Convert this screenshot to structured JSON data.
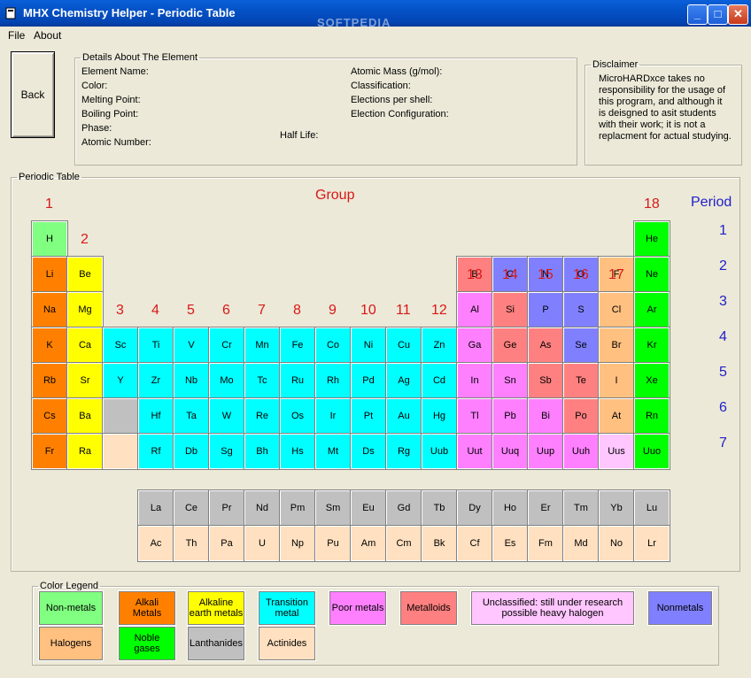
{
  "window": {
    "title": "MHX Chemistry Helper - Periodic Table",
    "watermark": "SOFTPEDIA",
    "watermark_url": "www.softpedia.com"
  },
  "menu": [
    "File",
    "About"
  ],
  "back_label": "Back",
  "details": {
    "legend": "Details About The Element",
    "left": [
      "Element Name:",
      "Color:",
      "Melting Point:",
      "Boiling Point:",
      "Phase:",
      "Atomic Number:"
    ],
    "right": [
      "Atomic Mass (g/mol):",
      "Classification:",
      "Elections per shell:",
      "Election Configuration:"
    ],
    "half_life": "Half Life:"
  },
  "disclaimer": {
    "legend": "Disclaimer",
    "text": "MicroHARDxce takes no responsibility for the usage of this program, and although it is deisgned to asit students  with their work; it is not a replacment for actual studying."
  },
  "periodic": {
    "legend": "Periodic Table",
    "group_title": "Group",
    "period_title": "Period",
    "groups": [
      "1",
      "2",
      "3",
      "4",
      "5",
      "6",
      "7",
      "8",
      "9",
      "10",
      "11",
      "12",
      "13",
      "14",
      "15",
      "16",
      "17",
      "18"
    ],
    "periods": [
      "1",
      "2",
      "3",
      "4",
      "5",
      "6",
      "7"
    ]
  },
  "colors": {
    "nonmetal": "#80ff80",
    "alkali": "#ff8000",
    "alkaline": "#ffff00",
    "transition": "#00ffff",
    "poor": "#ff80ff",
    "metalloid": "#ff8080",
    "unclassified": "#ffc6ff",
    "nonmetals": "#8080ff",
    "halogen": "#ffc080",
    "noble": "#00ff00",
    "lanthanide": "#c0c0c0",
    "actinide": "#ffe0c0",
    "blank": "#c0c0c0"
  },
  "elements": [
    {
      "s": "H",
      "r": 1,
      "c": 1,
      "t": "nonmetal"
    },
    {
      "s": "He",
      "r": 1,
      "c": 18,
      "t": "noble"
    },
    {
      "s": "Li",
      "r": 2,
      "c": 1,
      "t": "alkali"
    },
    {
      "s": "Be",
      "r": 2,
      "c": 2,
      "t": "alkaline"
    },
    {
      "s": "B",
      "r": 2,
      "c": 13,
      "t": "metalloid"
    },
    {
      "s": "C",
      "r": 2,
      "c": 14,
      "t": "nonmetals"
    },
    {
      "s": "N",
      "r": 2,
      "c": 15,
      "t": "nonmetals"
    },
    {
      "s": "O",
      "r": 2,
      "c": 16,
      "t": "nonmetals"
    },
    {
      "s": "F",
      "r": 2,
      "c": 17,
      "t": "halogen"
    },
    {
      "s": "Ne",
      "r": 2,
      "c": 18,
      "t": "noble"
    },
    {
      "s": "Na",
      "r": 3,
      "c": 1,
      "t": "alkali"
    },
    {
      "s": "Mg",
      "r": 3,
      "c": 2,
      "t": "alkaline"
    },
    {
      "s": "Al",
      "r": 3,
      "c": 13,
      "t": "poor"
    },
    {
      "s": "Si",
      "r": 3,
      "c": 14,
      "t": "metalloid"
    },
    {
      "s": "P",
      "r": 3,
      "c": 15,
      "t": "nonmetals"
    },
    {
      "s": "S",
      "r": 3,
      "c": 16,
      "t": "nonmetals"
    },
    {
      "s": "Cl",
      "r": 3,
      "c": 17,
      "t": "halogen"
    },
    {
      "s": "Ar",
      "r": 3,
      "c": 18,
      "t": "noble"
    },
    {
      "s": "K",
      "r": 4,
      "c": 1,
      "t": "alkali"
    },
    {
      "s": "Ca",
      "r": 4,
      "c": 2,
      "t": "alkaline"
    },
    {
      "s": "Sc",
      "r": 4,
      "c": 3,
      "t": "transition"
    },
    {
      "s": "Ti",
      "r": 4,
      "c": 4,
      "t": "transition"
    },
    {
      "s": "V",
      "r": 4,
      "c": 5,
      "t": "transition"
    },
    {
      "s": "Cr",
      "r": 4,
      "c": 6,
      "t": "transition"
    },
    {
      "s": "Mn",
      "r": 4,
      "c": 7,
      "t": "transition"
    },
    {
      "s": "Fe",
      "r": 4,
      "c": 8,
      "t": "transition"
    },
    {
      "s": "Co",
      "r": 4,
      "c": 9,
      "t": "transition"
    },
    {
      "s": "Ni",
      "r": 4,
      "c": 10,
      "t": "transition"
    },
    {
      "s": "Cu",
      "r": 4,
      "c": 11,
      "t": "transition"
    },
    {
      "s": "Zn",
      "r": 4,
      "c": 12,
      "t": "transition"
    },
    {
      "s": "Ga",
      "r": 4,
      "c": 13,
      "t": "poor"
    },
    {
      "s": "Ge",
      "r": 4,
      "c": 14,
      "t": "metalloid"
    },
    {
      "s": "As",
      "r": 4,
      "c": 15,
      "t": "metalloid"
    },
    {
      "s": "Se",
      "r": 4,
      "c": 16,
      "t": "nonmetals"
    },
    {
      "s": "Br",
      "r": 4,
      "c": 17,
      "t": "halogen"
    },
    {
      "s": "Kr",
      "r": 4,
      "c": 18,
      "t": "noble"
    },
    {
      "s": "Rb",
      "r": 5,
      "c": 1,
      "t": "alkali"
    },
    {
      "s": "Sr",
      "r": 5,
      "c": 2,
      "t": "alkaline"
    },
    {
      "s": "Y",
      "r": 5,
      "c": 3,
      "t": "transition"
    },
    {
      "s": "Zr",
      "r": 5,
      "c": 4,
      "t": "transition"
    },
    {
      "s": "Nb",
      "r": 5,
      "c": 5,
      "t": "transition"
    },
    {
      "s": "Mo",
      "r": 5,
      "c": 6,
      "t": "transition"
    },
    {
      "s": "Tc",
      "r": 5,
      "c": 7,
      "t": "transition"
    },
    {
      "s": "Ru",
      "r": 5,
      "c": 8,
      "t": "transition"
    },
    {
      "s": "Rh",
      "r": 5,
      "c": 9,
      "t": "transition"
    },
    {
      "s": "Pd",
      "r": 5,
      "c": 10,
      "t": "transition"
    },
    {
      "s": "Ag",
      "r": 5,
      "c": 11,
      "t": "transition"
    },
    {
      "s": "Cd",
      "r": 5,
      "c": 12,
      "t": "transition"
    },
    {
      "s": "In",
      "r": 5,
      "c": 13,
      "t": "poor"
    },
    {
      "s": "Sn",
      "r": 5,
      "c": 14,
      "t": "poor"
    },
    {
      "s": "Sb",
      "r": 5,
      "c": 15,
      "t": "metalloid"
    },
    {
      "s": "Te",
      "r": 5,
      "c": 16,
      "t": "metalloid"
    },
    {
      "s": "I",
      "r": 5,
      "c": 17,
      "t": "halogen"
    },
    {
      "s": "Xe",
      "r": 5,
      "c": 18,
      "t": "noble"
    },
    {
      "s": "Cs",
      "r": 6,
      "c": 1,
      "t": "alkali"
    },
    {
      "s": "Ba",
      "r": 6,
      "c": 2,
      "t": "alkaline"
    },
    {
      "s": "",
      "r": 6,
      "c": 3,
      "t": "blank"
    },
    {
      "s": "Hf",
      "r": 6,
      "c": 4,
      "t": "transition"
    },
    {
      "s": "Ta",
      "r": 6,
      "c": 5,
      "t": "transition"
    },
    {
      "s": "W",
      "r": 6,
      "c": 6,
      "t": "transition"
    },
    {
      "s": "Re",
      "r": 6,
      "c": 7,
      "t": "transition"
    },
    {
      "s": "Os",
      "r": 6,
      "c": 8,
      "t": "transition"
    },
    {
      "s": "Ir",
      "r": 6,
      "c": 9,
      "t": "transition"
    },
    {
      "s": "Pt",
      "r": 6,
      "c": 10,
      "t": "transition"
    },
    {
      "s": "Au",
      "r": 6,
      "c": 11,
      "t": "transition"
    },
    {
      "s": "Hg",
      "r": 6,
      "c": 12,
      "t": "transition"
    },
    {
      "s": "Tl",
      "r": 6,
      "c": 13,
      "t": "poor"
    },
    {
      "s": "Pb",
      "r": 6,
      "c": 14,
      "t": "poor"
    },
    {
      "s": "Bi",
      "r": 6,
      "c": 15,
      "t": "poor"
    },
    {
      "s": "Po",
      "r": 6,
      "c": 16,
      "t": "metalloid"
    },
    {
      "s": "At",
      "r": 6,
      "c": 17,
      "t": "halogen"
    },
    {
      "s": "Rn",
      "r": 6,
      "c": 18,
      "t": "noble"
    },
    {
      "s": "Fr",
      "r": 7,
      "c": 1,
      "t": "alkali"
    },
    {
      "s": "Ra",
      "r": 7,
      "c": 2,
      "t": "alkaline"
    },
    {
      "s": "",
      "r": 7,
      "c": 3,
      "t": "actinide"
    },
    {
      "s": "Rf",
      "r": 7,
      "c": 4,
      "t": "transition"
    },
    {
      "s": "Db",
      "r": 7,
      "c": 5,
      "t": "transition"
    },
    {
      "s": "Sg",
      "r": 7,
      "c": 6,
      "t": "transition"
    },
    {
      "s": "Bh",
      "r": 7,
      "c": 7,
      "t": "transition"
    },
    {
      "s": "Hs",
      "r": 7,
      "c": 8,
      "t": "transition"
    },
    {
      "s": "Mt",
      "r": 7,
      "c": 9,
      "t": "transition"
    },
    {
      "s": "Ds",
      "r": 7,
      "c": 10,
      "t": "transition"
    },
    {
      "s": "Rg",
      "r": 7,
      "c": 11,
      "t": "transition"
    },
    {
      "s": "Uub",
      "r": 7,
      "c": 12,
      "t": "transition"
    },
    {
      "s": "Uut",
      "r": 7,
      "c": 13,
      "t": "poor"
    },
    {
      "s": "Uuq",
      "r": 7,
      "c": 14,
      "t": "poor"
    },
    {
      "s": "Uup",
      "r": 7,
      "c": 15,
      "t": "poor"
    },
    {
      "s": "Uuh",
      "r": 7,
      "c": 16,
      "t": "poor"
    },
    {
      "s": "Uus",
      "r": 7,
      "c": 17,
      "t": "unclassified"
    },
    {
      "s": "Uuo",
      "r": 7,
      "c": 18,
      "t": "noble"
    }
  ],
  "lanthanides": [
    "La",
    "Ce",
    "Pr",
    "Nd",
    "Pm",
    "Sm",
    "Eu",
    "Gd",
    "Tb",
    "Dy",
    "Ho",
    "Er",
    "Tm",
    "Yb",
    "Lu"
  ],
  "actinides": [
    "Ac",
    "Th",
    "Pa",
    "U",
    "Np",
    "Pu",
    "Am",
    "Cm",
    "Bk",
    "Cf",
    "Es",
    "Fm",
    "Md",
    "No",
    "Lr"
  ],
  "legend": {
    "title": "Color Legend",
    "items": [
      {
        "label": "Non-metals",
        "t": "nonmetal"
      },
      {
        "label": "Alkali\nMetals",
        "t": "alkali"
      },
      {
        "label": "Alkaline\nearth metals",
        "t": "alkaline"
      },
      {
        "label": "Transition\nmetal",
        "t": "transition"
      },
      {
        "label": "Poor metals",
        "t": "poor"
      },
      {
        "label": "Metalloids",
        "t": "metalloid"
      },
      {
        "label": "Unclassified: still under research\npossible heavy  halogen",
        "t": "unclassified"
      },
      {
        "label": "Nonmetals",
        "t": "nonmetals"
      },
      {
        "label": "Halogens",
        "t": "halogen"
      },
      {
        "label": "Noble\ngases",
        "t": "noble"
      },
      {
        "label": "Lanthanides",
        "t": "lanthanide"
      },
      {
        "label": "Actinides",
        "t": "actinide"
      }
    ]
  }
}
